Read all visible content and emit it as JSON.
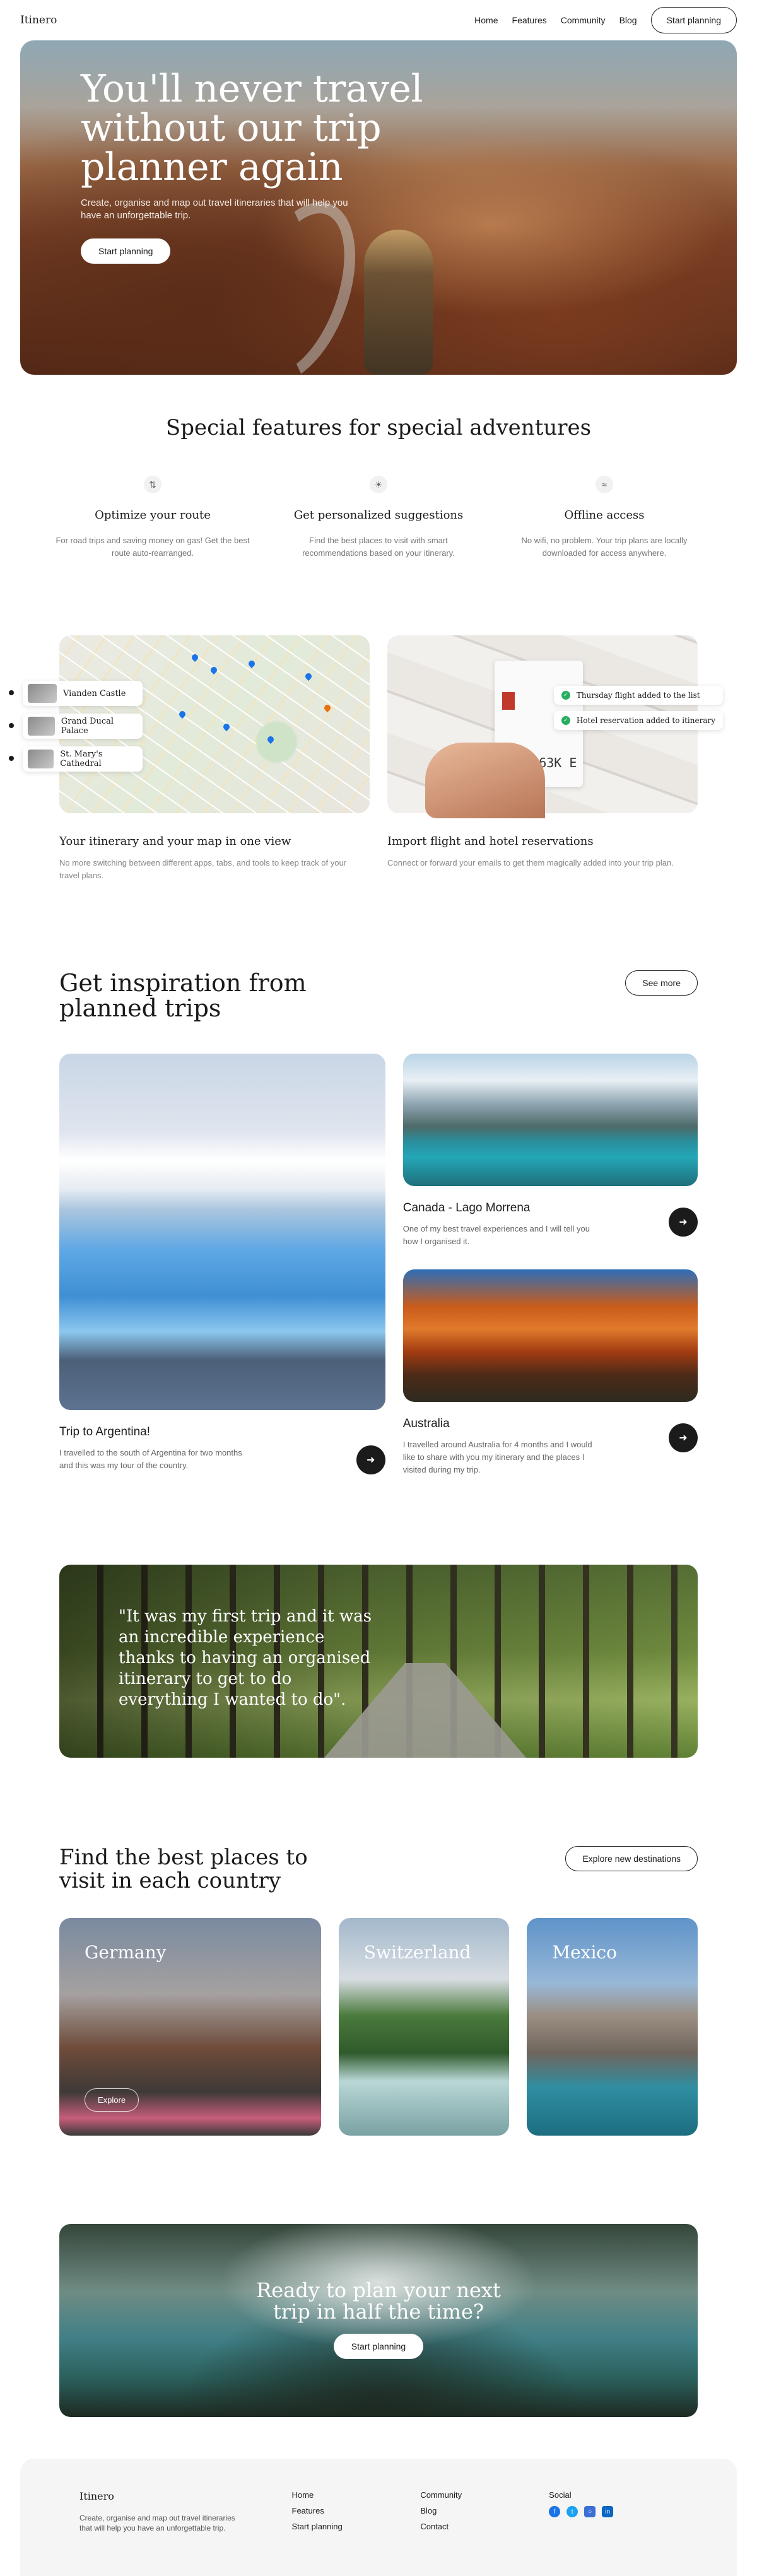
{
  "nav": {
    "logo": "Itinero",
    "links": [
      "Home",
      "Features",
      "Community",
      "Blog"
    ],
    "cta": "Start planning"
  },
  "hero": {
    "title": "You'll never travel without our trip planner again",
    "subtitle": "Create, organise and map out travel itineraries that will help you have an unforgettable trip.",
    "cta": "Start planning"
  },
  "features": {
    "title": "Special features for special adventures",
    "items": [
      {
        "icon": "route-icon",
        "title": "Optimize your route",
        "text": "For road trips and saving money on gas! Get the best route auto-rearranged."
      },
      {
        "icon": "lightbulb-icon",
        "title": "Get personalized suggestions",
        "text": "Find the best places to visit with smart recommendations based on your itinerary."
      },
      {
        "icon": "wifi-icon",
        "title": "Offline access",
        "text": "No wifi, no problem. Your trip plans are locally downloaded for access anywhere."
      }
    ]
  },
  "showcase": {
    "left": {
      "locations": [
        "Vianden Castle",
        "Grand Ducal Palace",
        "St. Mary's Cathedral"
      ],
      "title": "Your itinerary and your map in one view",
      "text": "No more switching between different apps, tabs, and tools to keep track of your travel plans."
    },
    "right": {
      "ticket_code": "2310 63K E",
      "notifications": [
        "Thursday flight added to the list",
        "Hotel reservation added to itinerary"
      ],
      "title": "Import flight and hotel reservations",
      "text": "Connect or forward your emails to get them magically added into your trip plan."
    }
  },
  "inspiration": {
    "title": "Get inspiration from planned trips",
    "cta": "See more",
    "trips": [
      {
        "title": "Trip to Argentina!",
        "text": "I travelled to the south of Argentina for two months and this was my tour of the country."
      },
      {
        "title": "Canada - Lago Morrena",
        "text": "One of my best travel experiences and I will tell you how I organised it."
      },
      {
        "title": "Australia",
        "text": "I travelled around Australia for 4 months and I would like to share with you my itinerary and the places I visited during my trip."
      }
    ]
  },
  "quote": {
    "text": "\"It was my first trip and it was an incredible experience thanks to having an organised itinerary to get to do everything I wanted to do\"."
  },
  "countries": {
    "title": "Find the best places to visit in each country",
    "cta": "Explore new destinations",
    "items": [
      "Germany",
      "Switzerland",
      "Mexico"
    ],
    "explore": "Explore"
  },
  "cta": {
    "title": "Ready to plan your next trip in half the time?",
    "button": "Start planning"
  },
  "footer": {
    "logo": "Itinero",
    "tagline": "Create, organise and map out travel itineraries that will help you have an unforgettable trip.",
    "col1": [
      "Home",
      "Features",
      "Start planning"
    ],
    "col2": [
      "Community",
      "Blog",
      "Contact"
    ],
    "social_title": "Social",
    "social_icons": [
      "facebook-icon",
      "twitter-icon",
      "instagram-icon",
      "linkedin-icon"
    ]
  }
}
